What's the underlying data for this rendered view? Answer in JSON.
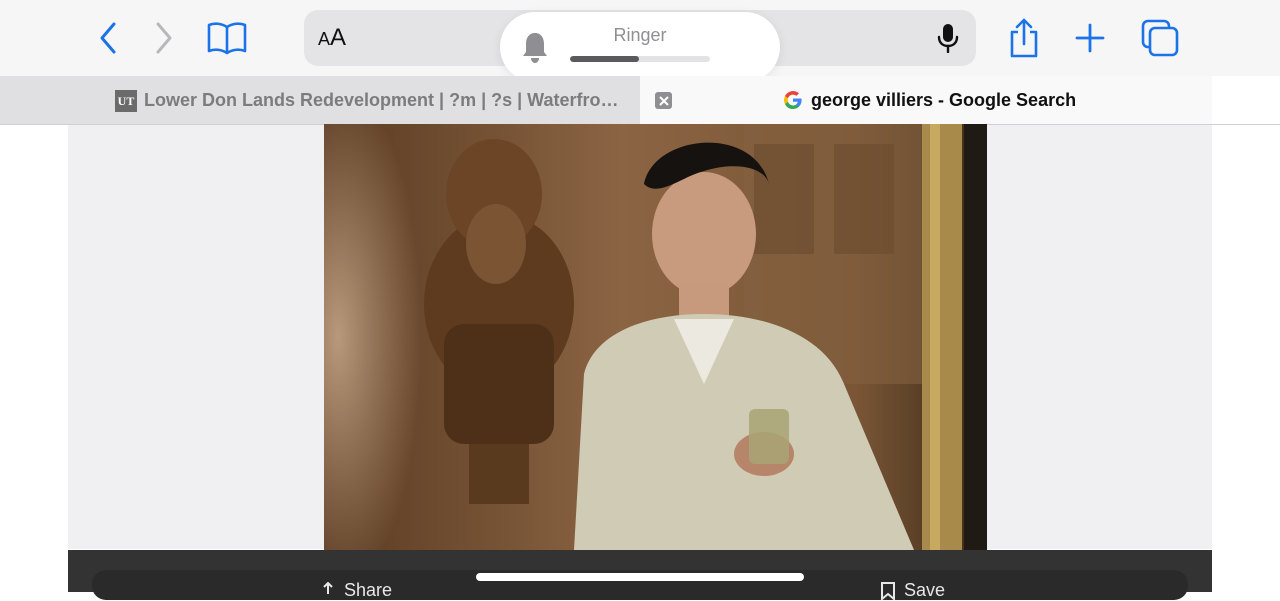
{
  "toolbar": {
    "text_size_big": "A",
    "text_size_small": "A",
    "icons": [
      "back-icon",
      "forward-icon",
      "bookmarks-icon",
      "microphone-icon",
      "share-icon",
      "new-tab-icon",
      "tabs-icon"
    ],
    "accent_color": "#1a73e8"
  },
  "ringer": {
    "label": "Ringer",
    "level": 0.49
  },
  "tabs": [
    {
      "favicon_text": "UT",
      "title": "Lower Don Lands Redevelopment | ?m | ?s | Waterfront…"
    },
    {
      "title": "george villiers - Google Search",
      "favicon": "google-icon"
    }
  ],
  "bottom_actions": {
    "share": "Share",
    "save": "Save"
  }
}
